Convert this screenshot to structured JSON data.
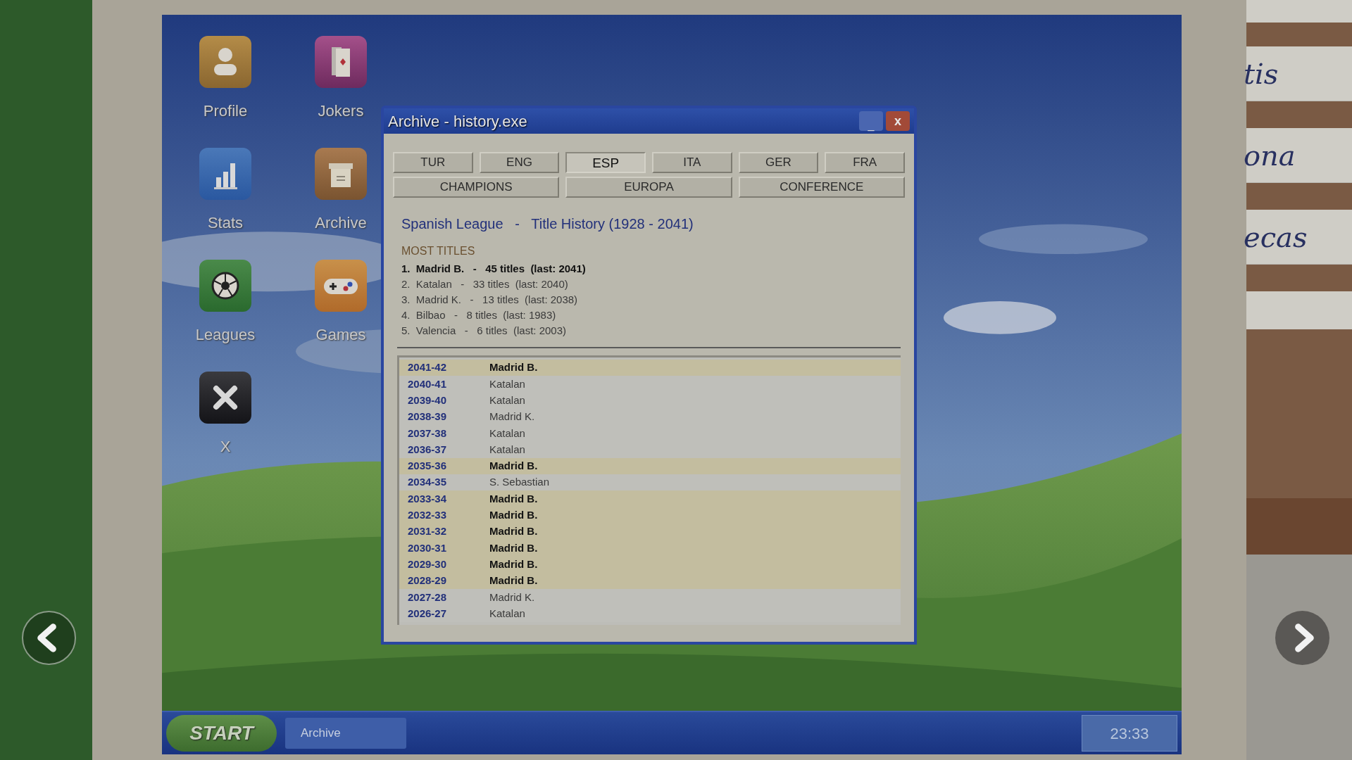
{
  "desktop_icons": [
    {
      "label": "Profile",
      "kind": "profile"
    },
    {
      "label": "Jokers",
      "kind": "jokers"
    },
    {
      "label": "Stats",
      "kind": "stats"
    },
    {
      "label": "Archive",
      "kind": "archive"
    },
    {
      "label": "Leagues",
      "kind": "leagues"
    },
    {
      "label": "Games",
      "kind": "games"
    },
    {
      "label": "X",
      "kind": "exit"
    }
  ],
  "window": {
    "title": "Archive - history.exe",
    "minimize": "_",
    "close": "x",
    "country_tabs": [
      {
        "label": "TUR",
        "selected": false
      },
      {
        "label": "ENG",
        "selected": false
      },
      {
        "label": "ESP",
        "selected": true
      },
      {
        "label": "ITA",
        "selected": false
      },
      {
        "label": "GER",
        "selected": false
      },
      {
        "label": "FRA",
        "selected": false
      }
    ],
    "competition_tabs": [
      {
        "label": "CHAMPIONS",
        "selected": false
      },
      {
        "label": "EUROPA",
        "selected": false
      },
      {
        "label": "CONFERENCE",
        "selected": false
      }
    ],
    "heading": "Spanish League   -   Title History (1928 - 2041)",
    "most_titles": {
      "label": "MOST TITLES",
      "entries": [
        {
          "text": "1.  Madrid B.   -   45 titles  (last: 2041)",
          "highlighted": true
        },
        {
          "text": "2.  Katalan   -   33 titles  (last: 2040)",
          "highlighted": false
        },
        {
          "text": "3.  Madrid K.   -   13 titles  (last: 2038)",
          "highlighted": false
        },
        {
          "text": "4.  Bilbao   -   8 titles  (last: 1983)",
          "highlighted": false
        },
        {
          "text": "5.  Valencia   -   6 titles  (last: 2003)",
          "highlighted": false
        }
      ]
    },
    "history": [
      {
        "season": "2041-42",
        "club": "Madrid B.",
        "highlighted": true
      },
      {
        "season": "2040-41",
        "club": "Katalan",
        "highlighted": false
      },
      {
        "season": "2039-40",
        "club": "Katalan",
        "highlighted": false
      },
      {
        "season": "2038-39",
        "club": "Madrid K.",
        "highlighted": false
      },
      {
        "season": "2037-38",
        "club": "Katalan",
        "highlighted": false
      },
      {
        "season": "2036-37",
        "club": "Katalan",
        "highlighted": false
      },
      {
        "season": "2035-36",
        "club": "Madrid B.",
        "highlighted": true
      },
      {
        "season": "2034-35",
        "club": "S. Sebastian",
        "highlighted": false
      },
      {
        "season": "2033-34",
        "club": "Madrid B.",
        "highlighted": true
      },
      {
        "season": "2032-33",
        "club": "Madrid B.",
        "highlighted": true
      },
      {
        "season": "2031-32",
        "club": "Madrid B.",
        "highlighted": true
      },
      {
        "season": "2030-31",
        "club": "Madrid B.",
        "highlighted": true
      },
      {
        "season": "2029-30",
        "club": "Madrid B.",
        "highlighted": true
      },
      {
        "season": "2028-29",
        "club": "Madrid B.",
        "highlighted": true
      },
      {
        "season": "2027-28",
        "club": "Madrid K.",
        "highlighted": false
      },
      {
        "season": "2026-27",
        "club": "Katalan",
        "highlighted": false
      }
    ]
  },
  "taskbar": {
    "start": "START",
    "tasks": [
      {
        "label": "Archive"
      }
    ],
    "clock": "23:33"
  },
  "cork_notes": [
    "tis",
    "ona",
    "ecas"
  ]
}
